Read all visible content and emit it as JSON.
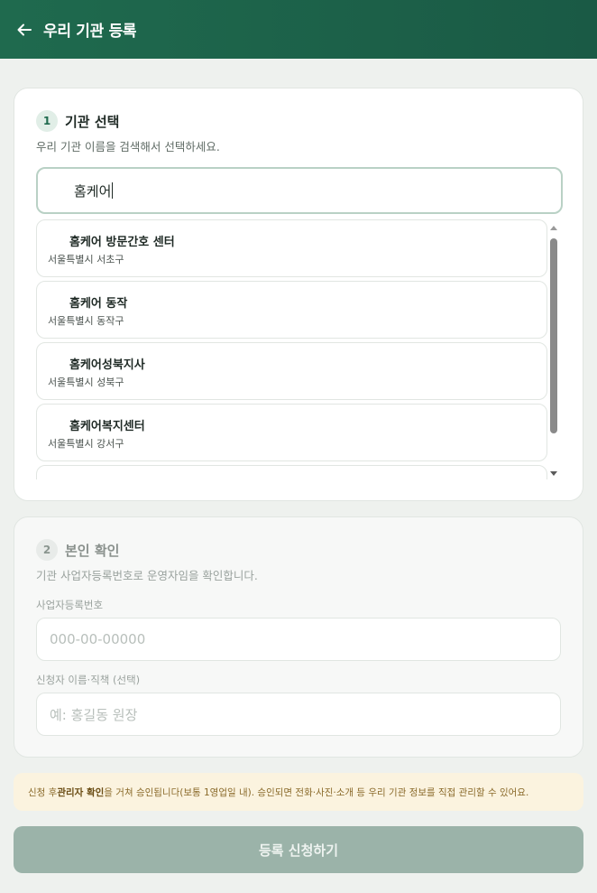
{
  "header": {
    "title": "우리 기관 등록"
  },
  "step1": {
    "number": "1",
    "title": "기관 선택",
    "description": "우리 기관 이름을 검색해서 선택하세요.",
    "search_value": "홈케어",
    "results": [
      {
        "name": "홈케어 방문간호 센터",
        "address": "서울특별시 서초구"
      },
      {
        "name": "홈케어 동작",
        "address": "서울특별시 동작구"
      },
      {
        "name": "홈케어성북지사",
        "address": "서울특별시 성북구"
      },
      {
        "name": "홈케어복지센터",
        "address": "서울특별시 강서구"
      }
    ]
  },
  "step2": {
    "number": "2",
    "title": "본인 확인",
    "description": "기관 사업자등록번호로 운영자임을 확인합니다.",
    "biz_label": "사업자등록번호",
    "biz_placeholder": "000-00-00000",
    "applicant_label": "신청자 이름·직책 (선택)",
    "applicant_placeholder": "예: 홍길동 원장"
  },
  "notice": {
    "prefix": "신청 후 ",
    "bold": "관리자 확인",
    "suffix": "을 거쳐 승인됩니다(보통 1영업일 내). 승인되면 전화·사진·소개 등 우리 기관 정보를 직접 관리할 수 있어요."
  },
  "submit_label": "등록 신청하기"
}
